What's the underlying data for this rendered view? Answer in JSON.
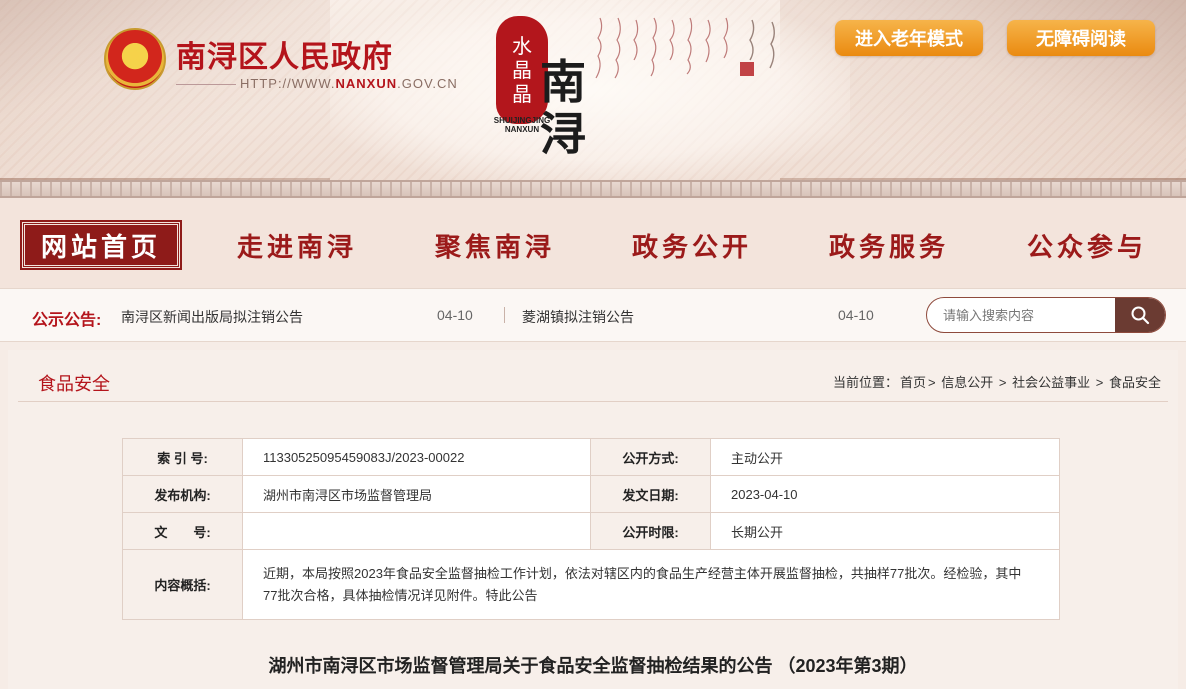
{
  "header": {
    "site_title": "南浔区人民政府",
    "url_prefix": "HTTP://WWW.",
    "url_domain": "NANXUN",
    "url_suffix": ".GOV.CN",
    "seal_text": [
      "水",
      "晶",
      "晶"
    ],
    "seal_sub_line1": "SHUIJINGJING",
    "seal_sub_line2": "NANXUN",
    "calligraphy": [
      "南",
      "浔"
    ],
    "elder_mode_label": "进入老年模式",
    "accessible_label": "无障碍阅读",
    "colors": {
      "brand_red": "#b4141b",
      "button_orange": "#ea8a10"
    }
  },
  "nav": {
    "items": [
      {
        "label": "网站首页",
        "active": true
      },
      {
        "label": "走进南浔",
        "active": false
      },
      {
        "label": "聚焦南浔",
        "active": false
      },
      {
        "label": "政务公开",
        "active": false
      },
      {
        "label": "政务服务",
        "active": false
      },
      {
        "label": "公众参与",
        "active": false
      }
    ]
  },
  "notice": {
    "label": "公示公告:",
    "items": [
      {
        "text": "南浔区新闻出版局拟注销公告",
        "date": "04-10"
      },
      {
        "text": "菱湖镇拟注销公告",
        "date": "04-10"
      }
    ]
  },
  "search": {
    "placeholder": "请输入搜索内容",
    "icon": "search-icon"
  },
  "content": {
    "section_title": "食品安全",
    "breadcrumb": {
      "prefix": "当前位置：",
      "path": [
        "首页",
        "信息公开",
        "社会公益事业",
        "食品安全"
      ],
      "separator": ">"
    },
    "meta": {
      "index_label": "索 引 号:",
      "index_value": "11330525095459083J/2023-00022",
      "open_method_label": "公开方式:",
      "open_method_value": "主动公开",
      "publisher_label": "发布机构:",
      "publisher_value": "湖州市南浔区市场监督管理局",
      "issue_date_label": "发文日期:",
      "issue_date_value": "2023-04-10",
      "doc_no_label": "文　　号:",
      "doc_no_value": "",
      "open_period_label": "公开时限:",
      "open_period_value": "长期公开",
      "summary_label": "内容概括:",
      "summary_value": "近期，本局按照2023年食品安全监督抽检工作计划，依法对辖区内的食品生产经营主体开展监督抽检，共抽样77批次。经检验，其中77批次合格，具体抽检情况详见附件。特此公告"
    },
    "article_title": "湖州市南浔区市场监督管理局关于食品安全监督抽检结果的公告 （2023年第3期）"
  }
}
